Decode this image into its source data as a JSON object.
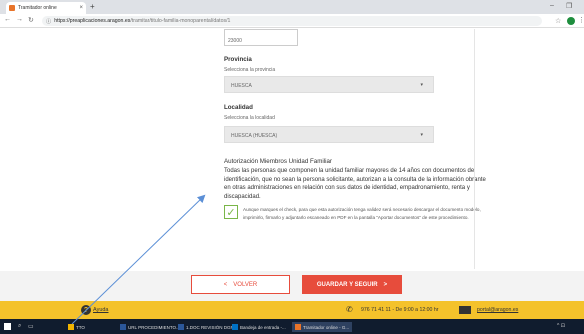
{
  "browser": {
    "tab_title": "Tramitador online",
    "tab_close": "×",
    "new_tab": "+",
    "url_host": "https://preaplicaciones.aragon.es",
    "url_path": "/tramitar/titulo-familia-monoparental/datos/1",
    "controls": {
      "minimize": "–",
      "restore": "❐"
    }
  },
  "form": {
    "top_input_value": "23000",
    "province": {
      "title": "Provincia",
      "subtitle": "Selecciona la provincia",
      "value": "HUESCA"
    },
    "locality": {
      "title": "Localidad",
      "subtitle": "Selecciona la localidad",
      "value": "HUESCA (HUESCA)"
    },
    "authorization": {
      "title": "Autorización Miembros Unidad Familiar",
      "body": "Todas las personas que componen la unidad familiar mayores de 14 años con documentos de identificación, que no sean la persona solicitante, autorizan a la consulta de la información obrante en otras administraciones en relación con sus datos de identidad, empadronamiento, renta y discapacidad.",
      "checked": true,
      "note": "Aunque marques el check, para que esta autorización tenga validez será necesario descargar el documento modelo, imprimirlo, firmarlo y adjuntarlo escaneado en PDF en la pantalla \"Aportar documentos\" de este procedimiento."
    }
  },
  "actions": {
    "back_label": "VOLVER",
    "back_icon": "<",
    "save_label": "GUARDAR Y SEGUIR",
    "save_icon": ">"
  },
  "help_bar": {
    "help_label": "Ayuda",
    "phone": "976 71 41 11 - De 9:00 a 12:00 hr",
    "email": "portal@aragon.es"
  },
  "taskbar": {
    "items": [
      {
        "label": "TTO",
        "color": "#f0b400"
      },
      {
        "label": "URL PROCEDIMIENTO...",
        "color": "#2b579a"
      },
      {
        "label": "1.DOC REVISIÓN DGR...",
        "color": "#2b579a"
      },
      {
        "label": "Bandeja de entrada -...",
        "color": "#0072c6"
      },
      {
        "label": "Tramitador online - G...",
        "color": "#e8742a"
      }
    ]
  },
  "colors": {
    "accent": "#e74c3c",
    "help_bar": "#f4c22b",
    "check": "#7ab648"
  }
}
